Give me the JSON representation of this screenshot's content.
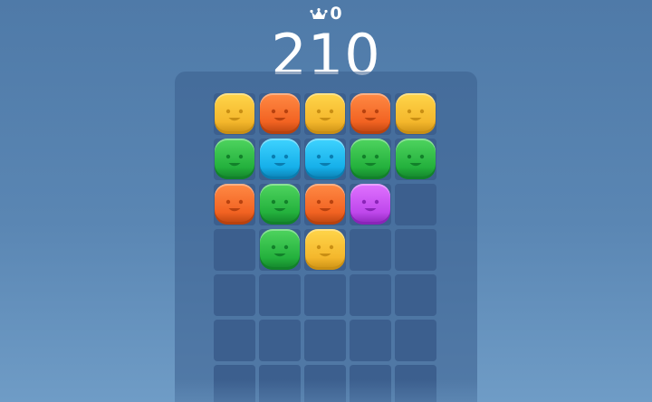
{
  "header": {
    "best_icon": "crown-icon",
    "best_score": "0",
    "score": "210"
  },
  "colors": {
    "yellow": [
      "#ffd54a",
      "#f4b72c",
      "#c98f14"
    ],
    "orange": [
      "#ff8a45",
      "#f26322",
      "#b8420f"
    ],
    "green": [
      "#4fd45f",
      "#24b13d",
      "#12812a"
    ],
    "blue": [
      "#3fd3ff",
      "#16b0ea",
      "#0a7db0"
    ],
    "purple": [
      "#e072ff",
      "#bf48ec",
      "#8a24b8"
    ]
  },
  "board": {
    "columns": 5,
    "rows": [
      [
        "yellow",
        "orange",
        "yellow",
        "orange",
        "yellow"
      ],
      [
        "green",
        "blue",
        "blue",
        "green",
        "green"
      ],
      [
        "orange",
        "green",
        "orange",
        "purple",
        null
      ],
      [
        null,
        "green",
        "yellow",
        null,
        null
      ],
      [
        null,
        null,
        null,
        null,
        null
      ],
      [
        null,
        null,
        null,
        null,
        null
      ],
      [
        null,
        null,
        null,
        null,
        null
      ]
    ]
  }
}
